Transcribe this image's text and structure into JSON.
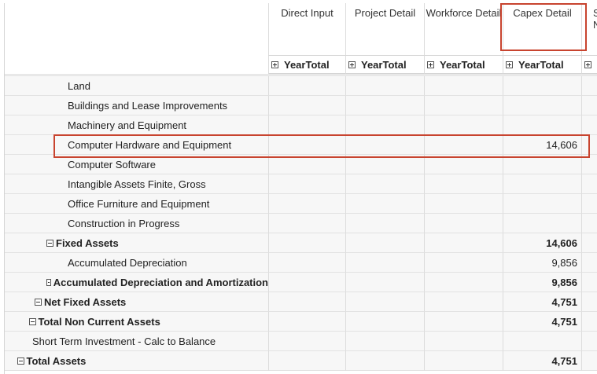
{
  "columns": [
    {
      "title": "Direct Input",
      "sub": "YearTotal"
    },
    {
      "title": "Project Detail",
      "sub": "YearTotal"
    },
    {
      "title": "Workforce Detail",
      "sub": "YearTotal"
    },
    {
      "title": "Capex Detail",
      "sub": "YearTotal"
    },
    {
      "title": "S\nN",
      "sub": ""
    }
  ],
  "rows": [
    {
      "label": "Land",
      "indent": 3,
      "bold": false,
      "toggle": null,
      "values": [
        "",
        "",
        "",
        ""
      ]
    },
    {
      "label": "Buildings and Lease Improvements",
      "indent": 3,
      "bold": false,
      "toggle": null,
      "values": [
        "",
        "",
        "",
        ""
      ]
    },
    {
      "label": "Machinery and Equipment",
      "indent": 3,
      "bold": false,
      "toggle": null,
      "values": [
        "",
        "",
        "",
        ""
      ]
    },
    {
      "label": "Computer Hardware and Equipment",
      "indent": 3,
      "bold": false,
      "toggle": null,
      "values": [
        "",
        "",
        "",
        "14,606"
      ]
    },
    {
      "label": "Computer Software",
      "indent": 3,
      "bold": false,
      "toggle": null,
      "values": [
        "",
        "",
        "",
        ""
      ]
    },
    {
      "label": "Intangible Assets Finite, Gross",
      "indent": 3,
      "bold": false,
      "toggle": null,
      "values": [
        "",
        "",
        "",
        ""
      ]
    },
    {
      "label": "Office Furniture and Equipment",
      "indent": 3,
      "bold": false,
      "toggle": null,
      "values": [
        "",
        "",
        "",
        ""
      ]
    },
    {
      "label": "Construction in Progress",
      "indent": 3,
      "bold": false,
      "toggle": null,
      "values": [
        "",
        "",
        "",
        ""
      ]
    },
    {
      "label": "Fixed Assets",
      "indent": 2,
      "bold": true,
      "toggle": "minus",
      "values": [
        "",
        "",
        "",
        "14,606"
      ]
    },
    {
      "label": "Accumulated Depreciation",
      "indent": 3,
      "bold": false,
      "toggle": null,
      "values": [
        "",
        "",
        "",
        "9,856"
      ]
    },
    {
      "label": "Accumulated Depreciation and Amortization",
      "indent": 2,
      "bold": true,
      "toggle": "minus",
      "values": [
        "",
        "",
        "",
        "9,856"
      ]
    },
    {
      "label": "Net Fixed Assets",
      "indent": 1,
      "bold": true,
      "toggle": "minus",
      "values": [
        "",
        "",
        "",
        "4,751"
      ]
    },
    {
      "label": "Total Non Current Assets",
      "indent": 0.5,
      "bold": true,
      "toggle": "minus",
      "values": [
        "",
        "",
        "",
        "4,751"
      ]
    },
    {
      "label": "Short Term Investment - Calc to Balance",
      "indent": 0,
      "bold": false,
      "toggle": null,
      "values": [
        "",
        "",
        "",
        ""
      ]
    },
    {
      "label": "Total Assets",
      "indent": -0.5,
      "bold": true,
      "toggle": "minus",
      "values": [
        "",
        "",
        "",
        "4,751"
      ]
    }
  ],
  "accent": "#c8442f"
}
